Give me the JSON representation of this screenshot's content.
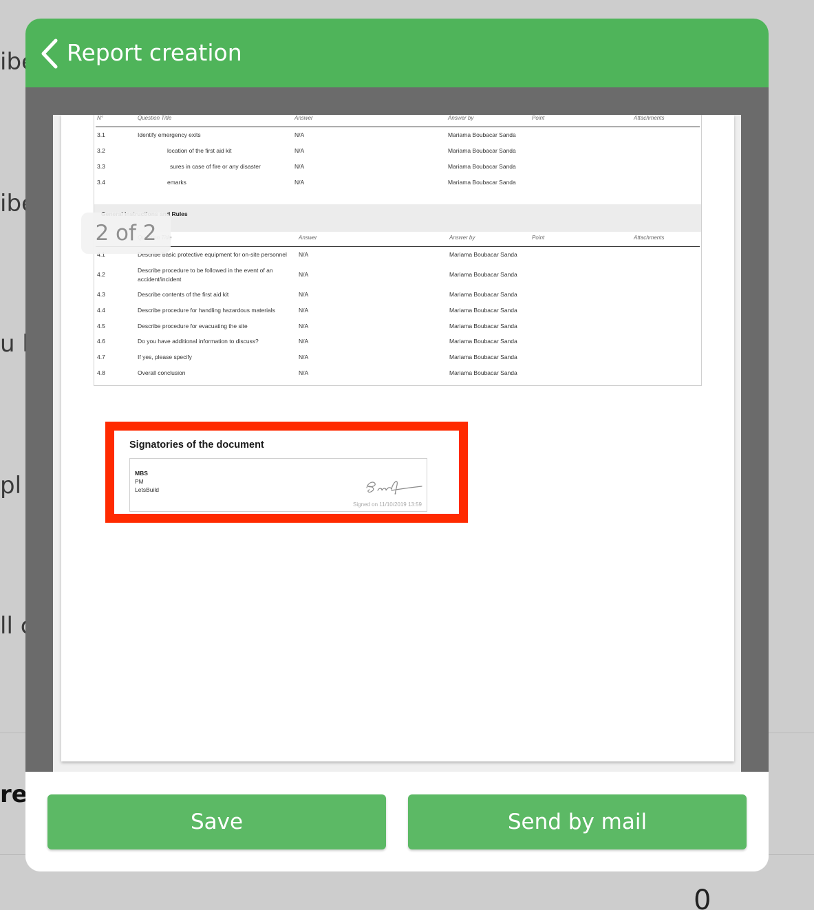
{
  "background": {
    "fragments": [
      "ibe",
      "ibe",
      "u h",
      "pl",
      "ll c",
      "re"
    ],
    "corner_glyph": "0"
  },
  "header": {
    "title": "Report creation",
    "back_icon": "chevron-left-icon",
    "color": "#4fb45a"
  },
  "viewer": {
    "page_indicator": "2 of 2"
  },
  "document": {
    "columns": [
      "N°",
      "Question Title",
      "Answer",
      "Answer by",
      "Point",
      "Attachments"
    ],
    "section3_rows": [
      {
        "n": "3.1",
        "title": "Identify emergency exits",
        "answer": "N/A",
        "by": "Mariama Boubacar Sanda"
      },
      {
        "n": "3.2",
        "title": "location of the first aid kit",
        "answer": "N/A",
        "by": "Mariama Boubacar Sanda"
      },
      {
        "n": "3.3",
        "title": "sures in case of fire or any disaster",
        "answer": "N/A",
        "by": "Mariama Boubacar Sanda"
      },
      {
        "n": "3.4",
        "title": "emarks",
        "answer": "N/A",
        "by": "Mariama Boubacar Sanda"
      }
    ],
    "section4_title": "General Instructions and Rules",
    "section4_rows": [
      {
        "n": "4.1",
        "title": "Describe basic protective equipment for on-site personnel",
        "answer": "N/A",
        "by": "Mariama Boubacar Sanda"
      },
      {
        "n": "4.2",
        "title": "Describe procedure to be followed in the event of an",
        "title2": "accident/incident",
        "answer": "N/A",
        "by": "Mariama Boubacar Sanda"
      },
      {
        "n": "4.3",
        "title": "Describe contents of the first aid kit",
        "answer": "N/A",
        "by": "Mariama Boubacar Sanda"
      },
      {
        "n": "4.4",
        "title": "Describe procedure for handling hazardous materials",
        "answer": "N/A",
        "by": "Mariama Boubacar Sanda"
      },
      {
        "n": "4.5",
        "title": "Describe procedure for evacuating the site",
        "answer": "N/A",
        "by": "Mariama Boubacar Sanda"
      },
      {
        "n": "4.6",
        "title": "Do you have additional information to discuss?",
        "answer": "N/A",
        "by": "Mariama Boubacar Sanda"
      },
      {
        "n": "4.7",
        "title": "If yes, please specify",
        "answer": "N/A",
        "by": "Mariama Boubacar Sanda"
      },
      {
        "n": "4.8",
        "title": "Overall conclusion",
        "answer": "N/A",
        "by": "Mariama Boubacar Sanda"
      }
    ],
    "signatories": {
      "title": "Signatories of the document",
      "name": "MBS",
      "role": "PM",
      "company": "LetsBuild",
      "signed": "Signed on 11/10/2019 13:59",
      "highlight_color": "#ff2a00"
    }
  },
  "footer": {
    "save_label": "Save",
    "mail_label": "Send by mail",
    "button_color": "#5cb965"
  }
}
